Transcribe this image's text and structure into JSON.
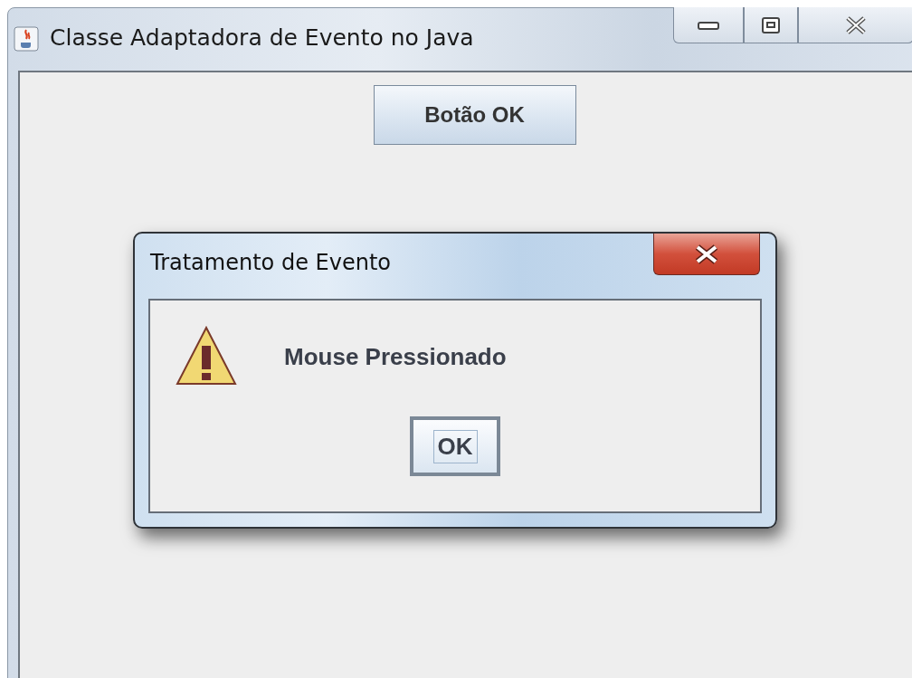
{
  "window": {
    "title": "Classe Adaptadora de Evento no Java",
    "controls": [
      {
        "kind": "minimize"
      },
      {
        "kind": "maximize"
      },
      {
        "kind": "close"
      }
    ]
  },
  "content": {
    "button": "Botão OK"
  },
  "dialog": {
    "title": "Tratamento de Evento",
    "message": "Mouse Pressionado",
    "button": "OK",
    "button_focused": true
  }
}
